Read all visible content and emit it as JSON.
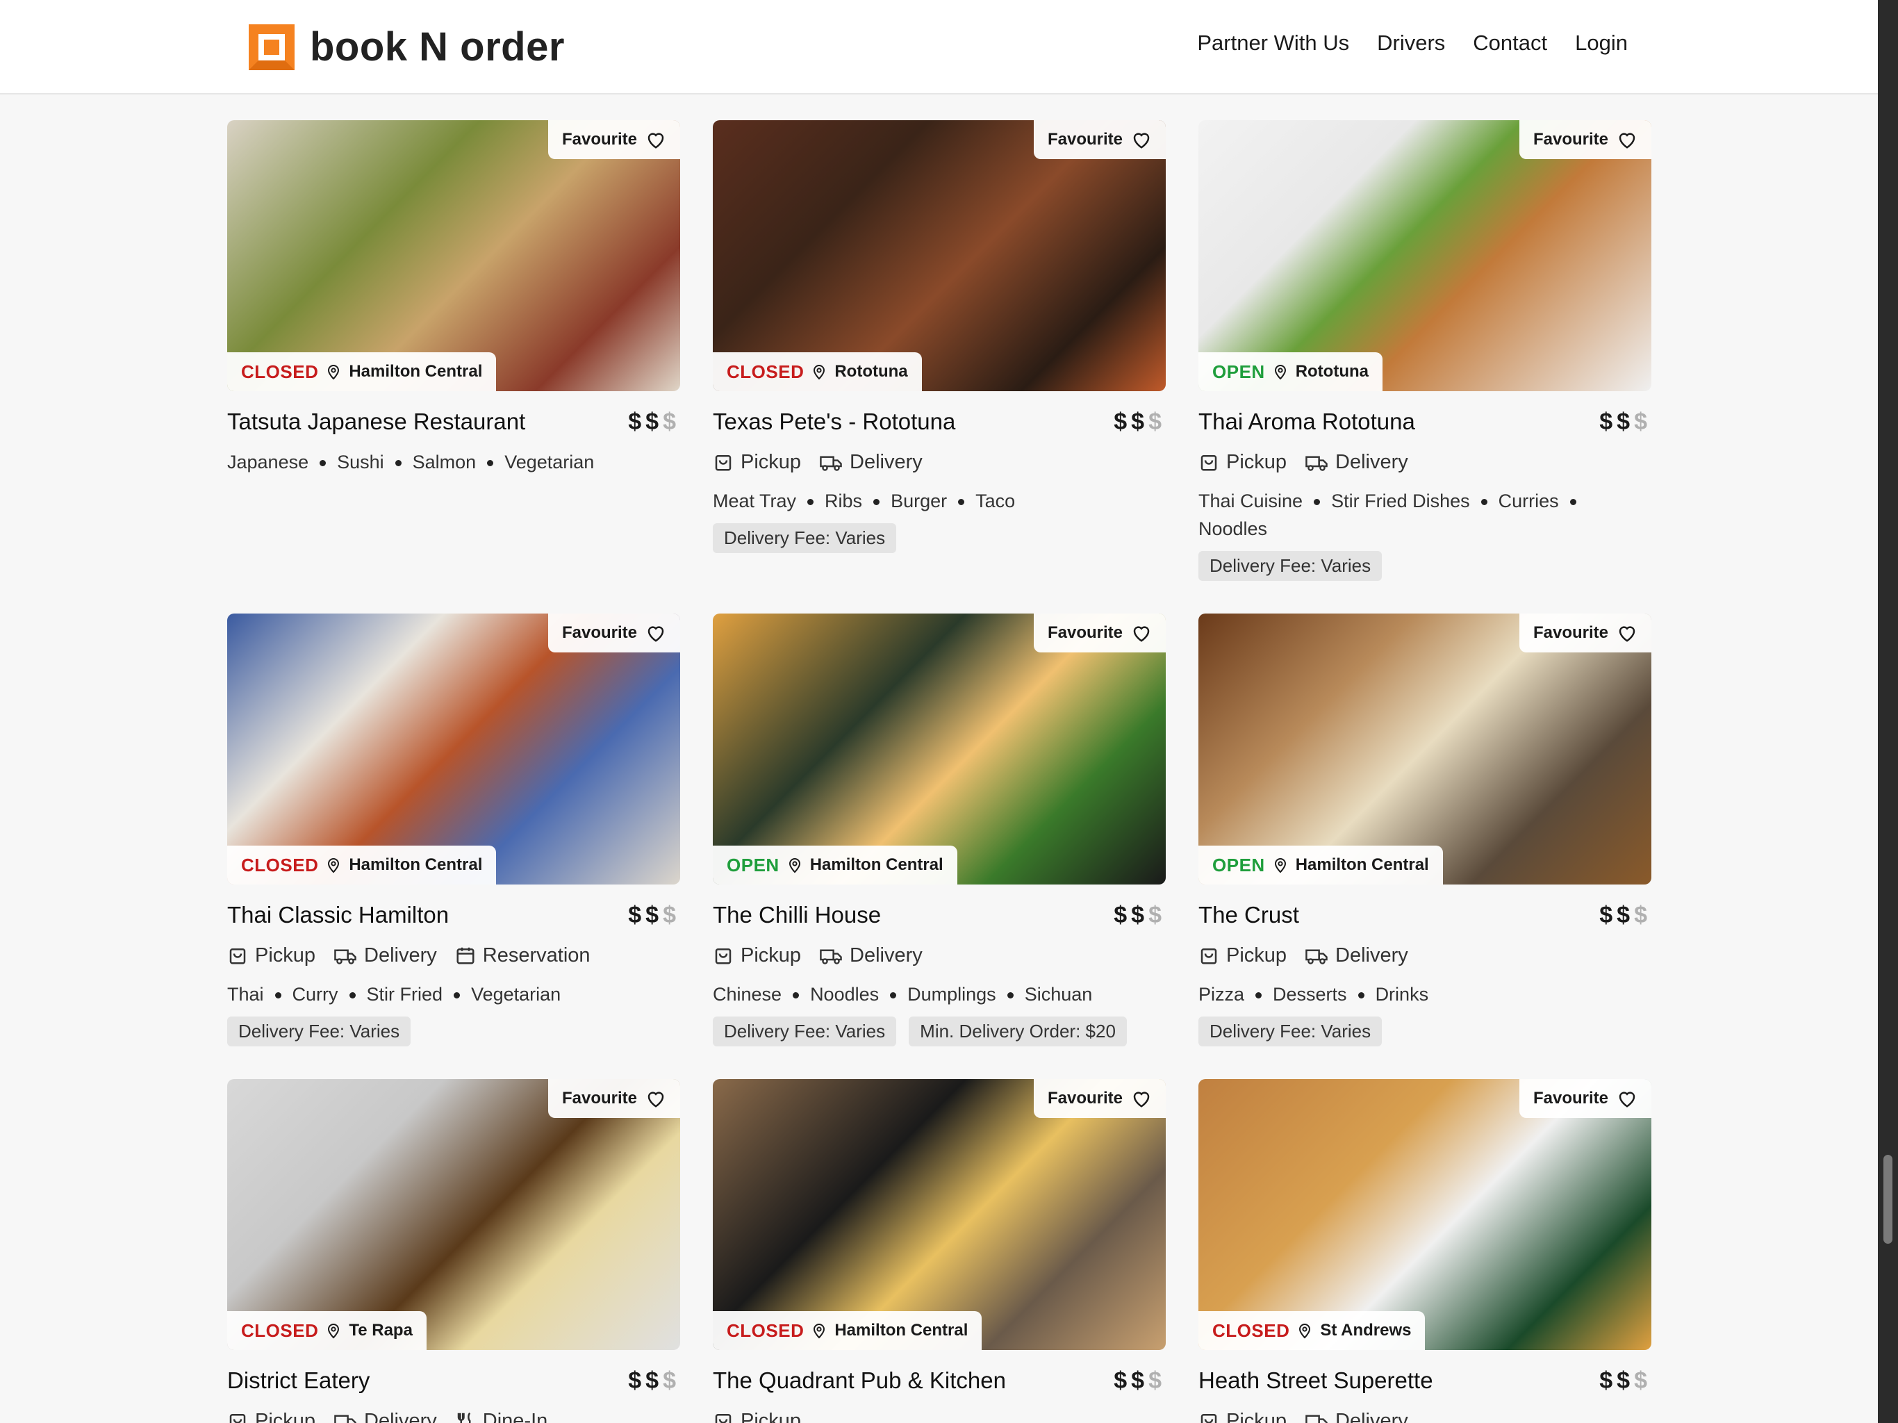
{
  "header": {
    "brand": "book N order",
    "nav": [
      "Partner With Us",
      "Drivers",
      "Contact",
      "Login"
    ]
  },
  "colors": {
    "brand_orange": "#f58220",
    "closed": "#c71c1c",
    "open": "#1f9e3c"
  },
  "labels": {
    "favourite": "Favourite",
    "dollar": "$"
  },
  "restaurants": [
    {
      "name": "Tatsuta Japanese Restaurant",
      "status": "CLOSED",
      "location": "Hamilton Central",
      "price_level": 2,
      "services": [],
      "tags": [
        "Japanese",
        "Sushi",
        "Salmon",
        "Vegetarian"
      ],
      "chips": []
    },
    {
      "name": "Texas Pete's - Rototuna",
      "status": "CLOSED",
      "location": "Rototuna",
      "price_level": 2,
      "services": [
        "Pickup",
        "Delivery"
      ],
      "tags": [
        "Meat Tray",
        "Ribs",
        "Burger",
        "Taco"
      ],
      "chips": [
        "Delivery Fee: Varies"
      ]
    },
    {
      "name": "Thai Aroma Rototuna",
      "status": "OPEN",
      "location": "Rototuna",
      "price_level": 2,
      "services": [
        "Pickup",
        "Delivery"
      ],
      "tags": [
        "Thai Cuisine",
        "Stir Fried Dishes",
        "Curries",
        "Noodles"
      ],
      "chips": [
        "Delivery Fee: Varies"
      ]
    },
    {
      "name": "Thai Classic Hamilton",
      "status": "CLOSED",
      "location": "Hamilton Central",
      "price_level": 2,
      "services": [
        "Pickup",
        "Delivery",
        "Reservation"
      ],
      "tags": [
        "Thai",
        "Curry",
        "Stir Fried",
        "Vegetarian"
      ],
      "chips": [
        "Delivery Fee: Varies"
      ]
    },
    {
      "name": "The Chilli House",
      "status": "OPEN",
      "location": "Hamilton Central",
      "price_level": 2,
      "services": [
        "Pickup",
        "Delivery"
      ],
      "tags": [
        "Chinese",
        "Noodles",
        "Dumplings",
        "Sichuan"
      ],
      "chips": [
        "Delivery Fee: Varies",
        "Min. Delivery Order: $20"
      ]
    },
    {
      "name": "The Crust",
      "status": "OPEN",
      "location": "Hamilton Central",
      "price_level": 2,
      "services": [
        "Pickup",
        "Delivery"
      ],
      "tags": [
        "Pizza",
        "Desserts",
        "Drinks"
      ],
      "chips": [
        "Delivery Fee: Varies"
      ]
    },
    {
      "name": "District Eatery",
      "status": "CLOSED",
      "location": "Te Rapa",
      "price_level": 2,
      "services": [
        "Pickup",
        "Delivery",
        "Dine-In"
      ],
      "tags": [],
      "chips": []
    },
    {
      "name": "The Quadrant Pub & Kitchen",
      "status": "CLOSED",
      "location": "Hamilton Central",
      "price_level": 2,
      "services": [
        "Pickup"
      ],
      "tags": [],
      "chips": []
    },
    {
      "name": "Heath Street Superette",
      "status": "CLOSED",
      "location": "St Andrews",
      "price_level": 2,
      "services": [
        "Pickup",
        "Delivery"
      ],
      "tags": [],
      "chips": []
    }
  ]
}
